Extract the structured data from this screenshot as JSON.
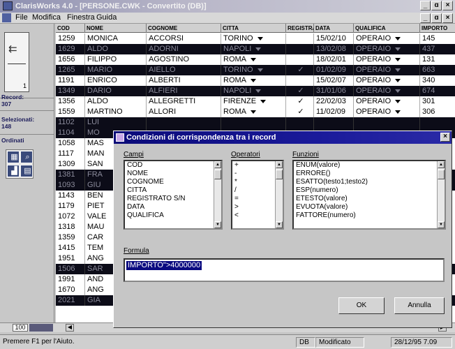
{
  "window": {
    "title": "ClarisWorks 4.0 - [PERSONE.CWK - Convertito (DB)]"
  },
  "menu": {
    "items": [
      "File",
      "Modifica",
      "Finestra",
      "Guida"
    ]
  },
  "left_panel": {
    "record_label": "Record:",
    "record_count": "307",
    "selected_label": "Selezionati:",
    "selected_count": "148",
    "sort_label": "Ordinati",
    "tool_number": "1"
  },
  "grid": {
    "columns": [
      "COD",
      "NOME",
      "COGNOME",
      "CITTA",
      "REGISTRATO S/N",
      "DATA",
      "QUALIFICA",
      "IMPORTO"
    ],
    "rows": [
      {
        "cod": "1259",
        "nome": "MONICA",
        "cognome": "ACCORSI",
        "citta": "TORINO",
        "reg": "",
        "data": "15/02/10",
        "qual": "OPERAIO",
        "imp": "145",
        "sel": false
      },
      {
        "cod": "1629",
        "nome": "ALDO",
        "cognome": "ADORNI",
        "citta": "NAPOLI",
        "reg": "",
        "data": "13/02/08",
        "qual": "OPERAIO",
        "imp": "437",
        "sel": true
      },
      {
        "cod": "1656",
        "nome": "FILIPPO",
        "cognome": "AGOSTINO",
        "citta": "ROMA",
        "reg": "",
        "data": "18/02/01",
        "qual": "OPERAIO",
        "imp": "131",
        "sel": false
      },
      {
        "cod": "1265",
        "nome": "MARIO",
        "cognome": "AIELLO",
        "citta": "TORINO",
        "reg": "✓",
        "data": "01/02/09",
        "qual": "OPERAIO",
        "imp": "663",
        "sel": true
      },
      {
        "cod": "1191",
        "nome": "ENRICO",
        "cognome": "ALBERTI",
        "citta": "ROMA",
        "reg": "",
        "data": "15/02/07",
        "qual": "OPERAIO",
        "imp": "340",
        "sel": false
      },
      {
        "cod": "1349",
        "nome": "DARIO",
        "cognome": "ALFIERI",
        "citta": "NAPOLI",
        "reg": "✓",
        "data": "31/01/06",
        "qual": "OPERAIO",
        "imp": "674",
        "sel": true
      },
      {
        "cod": "1356",
        "nome": "ALDO",
        "cognome": "ALLEGRETTI",
        "citta": "FIRENZE",
        "reg": "✓",
        "data": "22/02/03",
        "qual": "OPERAIO",
        "imp": "301",
        "sel": false
      },
      {
        "cod": "1559",
        "nome": "MARTINO",
        "cognome": "ALLORI",
        "citta": "ROMA",
        "reg": "✓",
        "data": "11/02/09",
        "qual": "OPERAIO",
        "imp": "306",
        "sel": false
      },
      {
        "cod": "1102",
        "nome": "LUI",
        "sel": true
      },
      {
        "cod": "1104",
        "nome": "MO",
        "sel": true
      },
      {
        "cod": "1058",
        "nome": "MAS",
        "sel": false
      },
      {
        "cod": "1117",
        "nome": "MAN",
        "sel": false
      },
      {
        "cod": "1309",
        "nome": "SAN",
        "sel": false
      },
      {
        "cod": "1381",
        "nome": "FRA",
        "sel": true
      },
      {
        "cod": "1093",
        "nome": "GIU",
        "sel": true
      },
      {
        "cod": "1143",
        "nome": "BEN",
        "sel": false
      },
      {
        "cod": "1179",
        "nome": "PIET",
        "sel": false
      },
      {
        "cod": "1072",
        "nome": "VALE",
        "sel": false
      },
      {
        "cod": "1318",
        "nome": "MAU",
        "sel": false
      },
      {
        "cod": "1359",
        "nome": "CAR",
        "sel": false
      },
      {
        "cod": "1415",
        "nome": "TEM",
        "sel": false
      },
      {
        "cod": "1951",
        "nome": "ANG",
        "sel": false
      },
      {
        "cod": "1506",
        "nome": "SAR",
        "sel": true
      },
      {
        "cod": "1991",
        "nome": "AND",
        "sel": false
      },
      {
        "cod": "1670",
        "nome": "ANG",
        "sel": false
      },
      {
        "cod": "2021",
        "nome": "GIA",
        "sel": true
      }
    ]
  },
  "zoom": "100",
  "status": {
    "help": "Premere F1 per l'Aiuto.",
    "mode": "DB",
    "state": "Modificato",
    "datetime": "28/12/95 7.09"
  },
  "dialog": {
    "title": "Condizioni di corrispondenza tra i record",
    "fields_label": "Campi",
    "fields": [
      "COD",
      "NOME",
      "COGNOME",
      "CITTA",
      "REGISTRATO S/N",
      "DATA",
      "QUALIFICA"
    ],
    "operators_label": "Operatori",
    "operators": [
      "+",
      "-",
      "*",
      "/",
      "=",
      ">",
      "<"
    ],
    "functions_label": "Funzioni",
    "functions": [
      "ENUM(valore)",
      "ERRORE()",
      "ESATTO(testo1;testo2)",
      "ESP(numero)",
      "ETESTO(valore)",
      "EVUOTA(valore)",
      "FATTORE(numero)"
    ],
    "formula_label": "Formula",
    "formula_value": "IMPORTO\">4000000",
    "ok_label": "OK",
    "cancel_label": "Annulla"
  }
}
